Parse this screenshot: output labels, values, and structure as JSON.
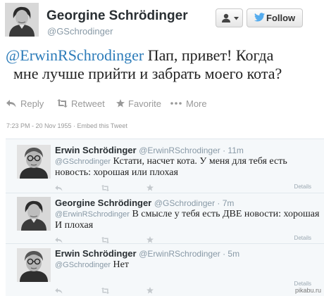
{
  "main_tweet": {
    "author_name": "Georgine Schrödinger",
    "author_handle": "@GSchrodinger",
    "follow_label": "Follow",
    "mention": "@ErwinRSchrodinger",
    "text_line1": " Пап, привет! Когда",
    "text_line2": "мне лучше прийти и забрать моего кота?",
    "actions": {
      "reply": "Reply",
      "retweet": "Retweet",
      "favorite": "Favorite",
      "more": "More"
    },
    "timestamp": "7:23 PM - 20 Nov 1955 · Embed this Tweet"
  },
  "replies": [
    {
      "author_name": "Erwin Schrödinger",
      "author_handle": "@ErwinRSchrodinger · 11m",
      "mention": "@GSchrodinger",
      "text": " Кстати, насчет кота. У меня для тебя есть новость: хорошая или плохая",
      "details": "Details"
    },
    {
      "author_name": "Georgine Schrödinger",
      "author_handle": "@GSchrodinger · 7m",
      "mention": "@ErwinRSchrodinger",
      "text": " В смысле у тебя есть ДВЕ новости: хорошая И плохая",
      "details": "Details"
    },
    {
      "author_name": "Erwin Schrödinger",
      "author_handle": "@ErwinRSchrodinger · 5m",
      "mention": "@GSchrodinger",
      "text": " Нет",
      "details": "Details"
    }
  ],
  "watermark": "pikabu.ru",
  "colors": {
    "link": "#2b7bb9",
    "muted": "#999999",
    "thread_bg": "#f5f8fa",
    "twitter_blue": "#55acee"
  },
  "icons": [
    "user-icon",
    "caret-down-icon",
    "twitter-bird-icon",
    "reply-icon",
    "retweet-icon",
    "star-icon",
    "more-dots-icon"
  ]
}
